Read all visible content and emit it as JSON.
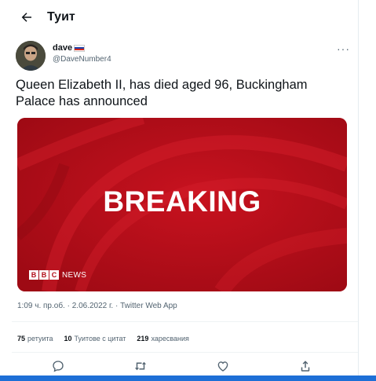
{
  "header": {
    "title": "Туит",
    "back_icon": "arrow-left-icon"
  },
  "author": {
    "display_name": "dave",
    "username": "@DaveNumber4",
    "flag_colors": [
      "#ffffff",
      "#1c3fa8",
      "#d52b1e"
    ]
  },
  "tweet": {
    "text": "Queen Elizabeth II, has died aged 96, Buckingham Palace has announced"
  },
  "media": {
    "headline": "BREAKING",
    "logo_letters": [
      "B",
      "B",
      "C"
    ],
    "logo_label": "NEWS",
    "background": "#b20d18"
  },
  "meta": {
    "time": "1:09 ч. пр.об.",
    "date": "2.06.2022 г.",
    "source": "Twitter Web App"
  },
  "stats": [
    {
      "count": "75",
      "label": "ретуита"
    },
    {
      "count": "10",
      "label": "Туитове с цитат"
    },
    {
      "count": "219",
      "label": "харесвания"
    }
  ],
  "actions": [
    "reply-icon",
    "retweet-icon",
    "like-icon",
    "share-icon"
  ],
  "accent": "#1d6fd6"
}
